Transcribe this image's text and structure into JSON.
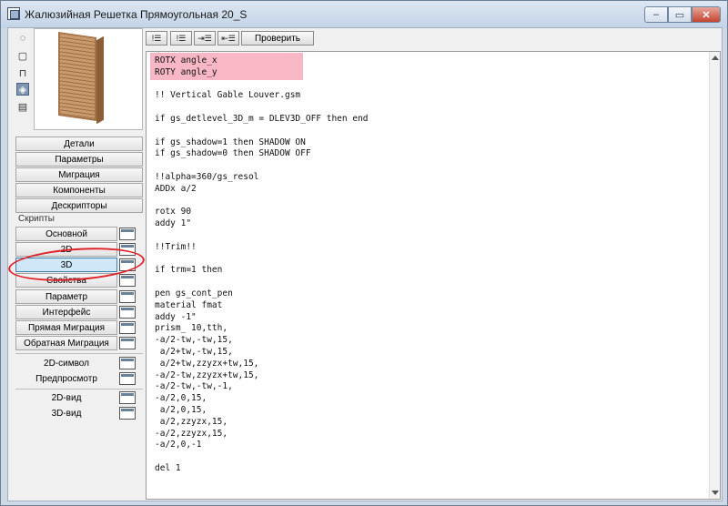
{
  "window": {
    "title": "Жалюзийная Решетка Прямоугольная 20_S",
    "controls": {
      "minimize": "–",
      "maximize": "▭",
      "close": "✕"
    }
  },
  "view_icons": [
    "square-dashed-icon",
    "square-icon",
    "stand-icon",
    "cube-icon",
    "film-icon"
  ],
  "nav_buttons": {
    "details": "Детали",
    "parameters": "Параметры",
    "migration": "Миграция",
    "components": "Компоненты",
    "descriptors": "Дескрипторы"
  },
  "scripts_label": "Скрипты",
  "scripts": [
    {
      "label": "Основной"
    },
    {
      "label": "2D"
    },
    {
      "label": "3D"
    },
    {
      "label": "Свойства"
    },
    {
      "label": "Параметр"
    },
    {
      "label": "Интерфейс"
    },
    {
      "label": "Прямая Миграция"
    },
    {
      "label": "Обратная Миграция"
    }
  ],
  "extra_scripts": [
    {
      "label": "2D-символ"
    },
    {
      "label": "Предпросмотр"
    }
  ],
  "views": [
    {
      "label": "2D-вид"
    },
    {
      "label": "3D-вид"
    }
  ],
  "toolbar": {
    "btn1": "!☰",
    "btn2": "!☰",
    "btn3": "⇥☰",
    "btn4": "⇤☰",
    "check": "Проверить"
  },
  "code_lines": [
    "ROTX angle_x",
    "ROTY angle_y",
    "",
    "!! Vertical Gable Louver.gsm",
    "",
    "if gs_detlevel_3D_m = DLEV3D_OFF then end",
    "",
    "if gs_shadow=1 then SHADOW ON",
    "if gs_shadow=0 then SHADOW OFF",
    "",
    "!!alpha=360/gs_resol",
    "ADDx a/2",
    "",
    "rotx 90",
    "addy 1\"",
    "",
    "!!Trim!!",
    "",
    "if trm=1 then",
    "",
    "pen gs_cont_pen",
    "material fmat",
    "addy -1\"",
    "prism_ 10,tth,",
    "-a/2-tw,-tw,15,",
    " a/2+tw,-tw,15,",
    " a/2+tw,zzyzx+tw,15,",
    "-a/2-tw,zzyzx+tw,15,",
    "-a/2-tw,-tw,-1,",
    "-a/2,0,15,",
    " a/2,0,15,",
    " a/2,zzyzx,15,",
    "-a/2,zzyzx,15,",
    "-a/2,0,-1",
    "",
    "del 1"
  ]
}
